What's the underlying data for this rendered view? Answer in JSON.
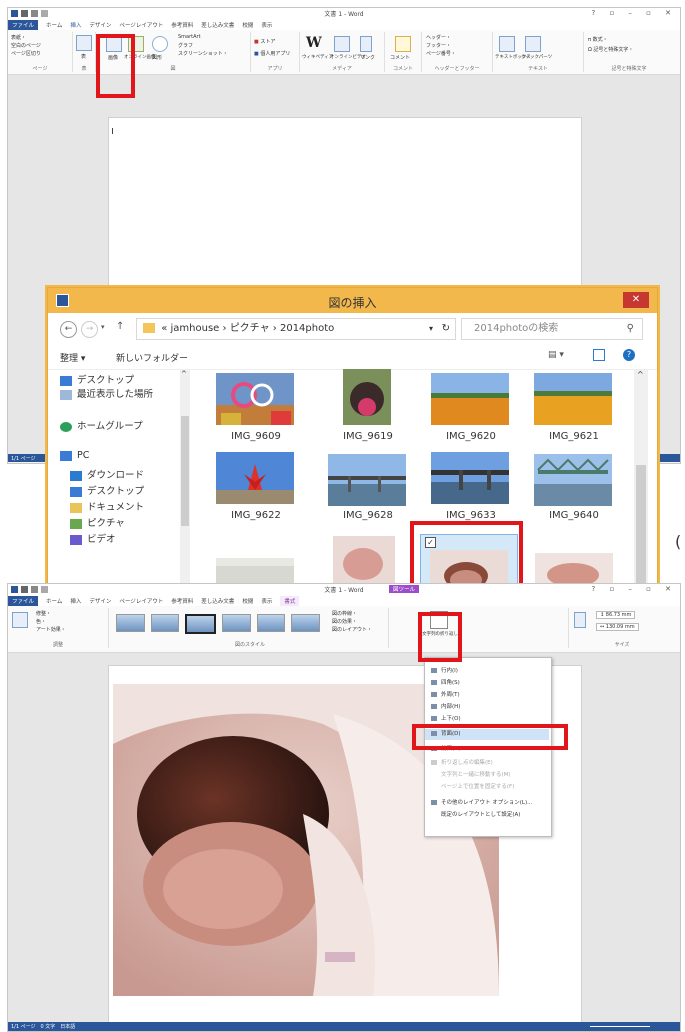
{
  "word_top": {
    "title": "文書 1 - Word",
    "tabs": [
      "ファイル",
      "ホーム",
      "挿入",
      "デザイン",
      "ページレイアウト",
      "参考資料",
      "差し込み文書",
      "校閲",
      "表示"
    ],
    "groups": [
      "ページ",
      "表",
      "図",
      "アプリ",
      "メディア",
      "コメント",
      "ヘッダーとフッター",
      "テキスト",
      "記号と特殊文字"
    ],
    "items": {
      "cover": "表紙・",
      "blank": "空白のページ",
      "pagebreak": "ページ区切り",
      "table": "表",
      "picture": "画像",
      "online_pic": "オンライン画像",
      "shapes": "図形",
      "smartart": "SmartArt",
      "graph": "グラフ",
      "screenshot": "スクリーンショット・",
      "store": "ストア",
      "myapps": "個人用アプリ",
      "wiki": "ウィキペディア",
      "online_video": "オンラインビデオ",
      "link": "リンク",
      "comment": "コメント",
      "header": "ヘッダー・",
      "footer": "フッター・",
      "pagenum": "ページ番号・",
      "textbox": "テキストボックス",
      "quickparts": "クイックパーツ",
      "equation": "π 数式・",
      "symbol": "Ω 記号と特殊文字・"
    },
    "status_left": "1/1 ページ"
  },
  "dialog": {
    "title": "図の挿入",
    "close": "✕",
    "path": [
      "jamhouse",
      "ピクチャ",
      "2014photo"
    ],
    "path_prefix": "«",
    "search_placeholder": "2014photoの検索",
    "organize": "整理 ▾",
    "new_folder": "新しいフォルダー",
    "nav_items": [
      "デスクトップ",
      "最近表示した場所",
      "ホームグループ",
      "PC",
      "ダウンロード",
      "デスクトップ",
      "ドキュメント",
      "ピクチャ",
      "ビデオ"
    ],
    "photos": [
      "IMG_9609",
      "IMG_9619",
      "IMG_9620",
      "IMG_9621",
      "IMG_9622",
      "IMG_9628",
      "IMG_9633",
      "IMG_9640"
    ],
    "right_mark": "("
  },
  "word_bottom": {
    "title": "文書 1 - Word",
    "context_tab": "図ツール",
    "tabs": [
      "ファイル",
      "ホーム",
      "挿入",
      "デザイン",
      "ページレイアウト",
      "参考資料",
      "差し込み文書",
      "校閲",
      "表示",
      "書式"
    ],
    "wrap_button": "文字列の折り返し",
    "size_h": "86.73 mm",
    "size_w": "130.09 mm",
    "groups": [
      "調整",
      "図のスタイル",
      "サイズ"
    ],
    "left_items": [
      "修整・",
      "色・",
      "アート効果・"
    ],
    "style_items": [
      "図の枠線・",
      "図の効果・",
      "図のレイアウト・"
    ],
    "menu_items": [
      "行内(I)",
      "四角(S)",
      "外周(T)",
      "内部(H)",
      "上下(O)",
      "背面(D)",
      "前面(N)",
      "折り返し点の編集(E)",
      "文字列と一緒に移動する(M)",
      "ページ上で位置を固定する(F)",
      "その他のレイアウト オプション(L)...",
      "既定のレイアウトとして設定(A)"
    ],
    "status_left": "1/1 ページ　0 文字　日本語"
  }
}
